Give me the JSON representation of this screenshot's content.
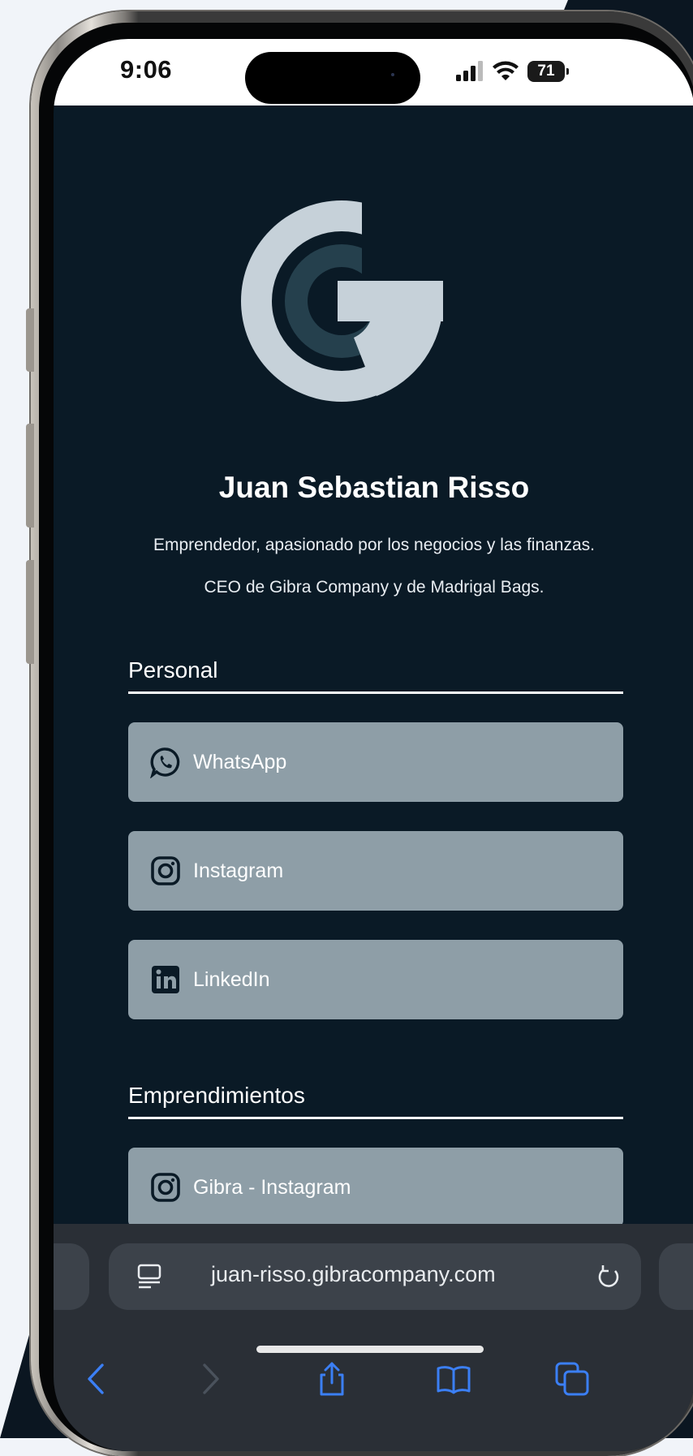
{
  "colors": {
    "page_bg": "#0a1a26",
    "button_bg": "#8e9ea7",
    "logo_light": "#c6d1d9",
    "logo_mid": "#25404d",
    "browser_accent": "#3b7ff5"
  },
  "status_bar": {
    "time": "9:06",
    "battery": "71"
  },
  "profile": {
    "logo_icon": "gibra-logo-icon",
    "name": "Juan Sebastian Risso",
    "description_1": "Emprendedor, apasionado por los negocios y las finanzas.",
    "description_2": "CEO de Gibra Company y de Madrigal Bags."
  },
  "sections": {
    "personal": {
      "title": "Personal",
      "links": [
        {
          "label": "WhatsApp",
          "icon": "whatsapp-icon"
        },
        {
          "label": "Instagram",
          "icon": "instagram-icon"
        },
        {
          "label": "LinkedIn",
          "icon": "linkedin-icon"
        }
      ]
    },
    "ventures": {
      "title": "Emprendimientos",
      "links": [
        {
          "label": "Gibra - Instagram",
          "icon": "instagram-icon"
        }
      ]
    }
  },
  "browser": {
    "url": "juan-risso.gibracompany.com",
    "toolbar": [
      "back-icon",
      "forward-icon",
      "share-icon",
      "bookmarks-icon",
      "tabs-icon"
    ]
  }
}
